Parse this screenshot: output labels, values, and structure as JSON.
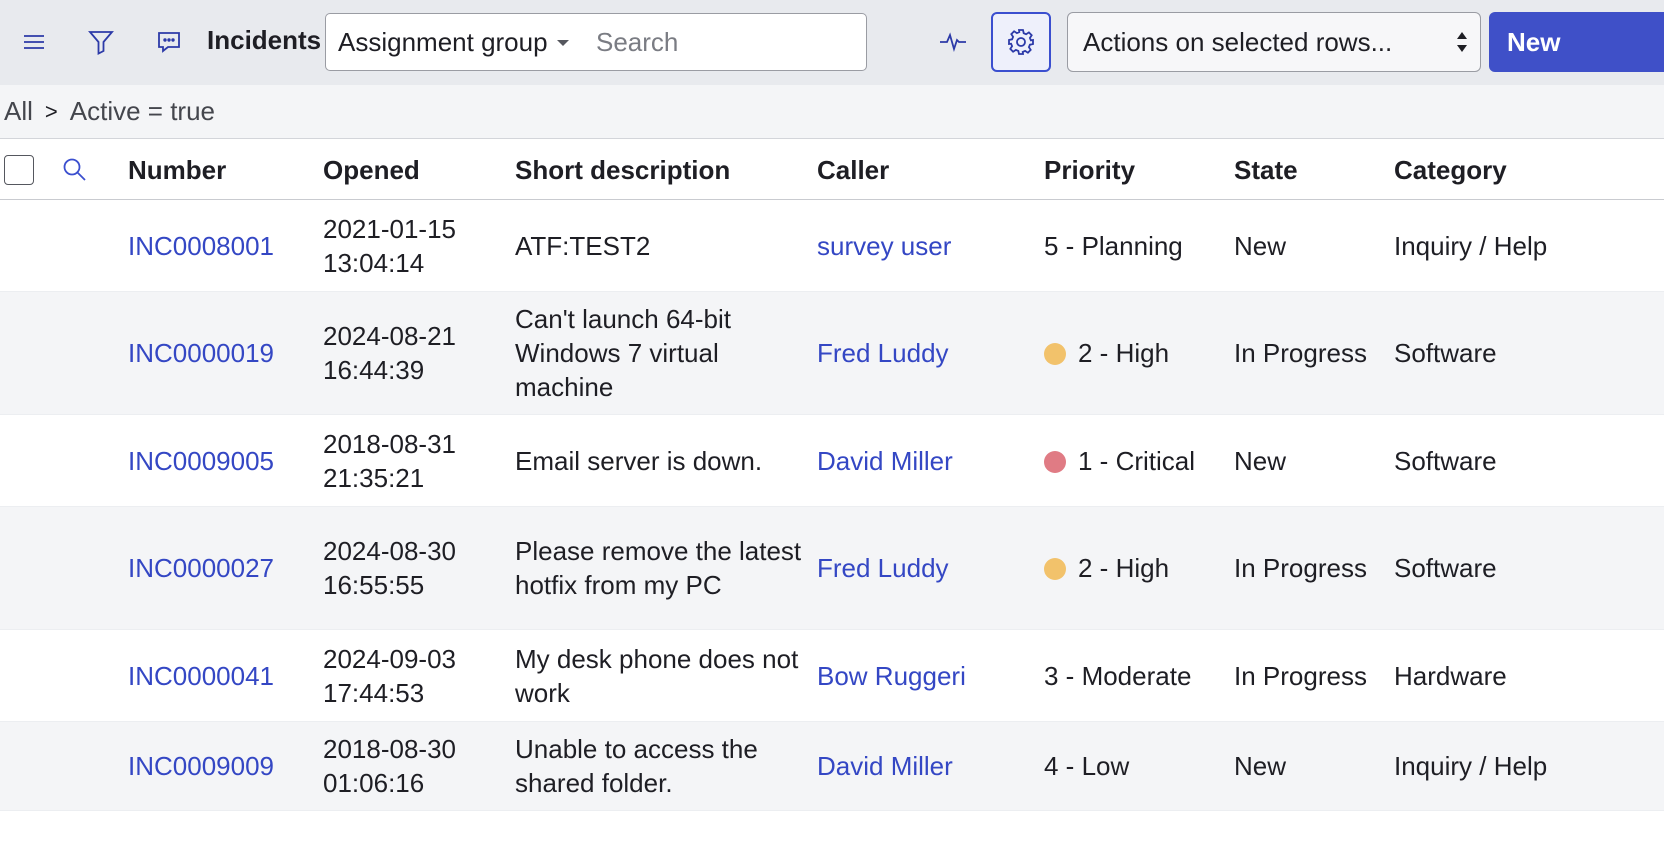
{
  "header": {
    "menu_icon": "hamburger-menu-icon",
    "filter_icon": "filter-funnel-icon",
    "comment_icon": "chat-bubble-icon",
    "title": "Incidents",
    "group_select_value": "Assignment group",
    "search_placeholder": "Search",
    "activity_icon": "pulse-activity-icon",
    "settings_icon": "gear-icon",
    "actions_select_value": "Actions on selected rows...",
    "new_label": "New",
    "accent_color": "#3f50c8"
  },
  "breadcrumb": {
    "root": "All",
    "separator": ">",
    "filter": "Active = true"
  },
  "table": {
    "columns": [
      "Number",
      "Opened",
      "Short description",
      "Caller",
      "Priority",
      "State",
      "Category"
    ],
    "rows": [
      {
        "number": "INC0008001",
        "opened": [
          "2021-01-15",
          "13:04:14"
        ],
        "description": "ATF:TEST2",
        "caller": "survey user",
        "priority": "5 - Planning",
        "priority_dot": "",
        "state": "New",
        "category": "Inquiry / Help"
      },
      {
        "number": "INC0000019",
        "opened": [
          "2024-08-21",
          "16:44:39"
        ],
        "description": "Can't launch 64-bit Windows 7 virtual machine",
        "caller": "Fred Luddy",
        "priority": "2 - High",
        "priority_dot": "#f2c26b",
        "state": "In Progress",
        "category": "Software"
      },
      {
        "number": "INC0009005",
        "opened": [
          "2018-08-31",
          "21:35:21"
        ],
        "description": "Email server is down.",
        "caller": "David Miller",
        "priority": "1 - Critical",
        "priority_dot": "#e07b84",
        "state": "New",
        "category": "Software"
      },
      {
        "number": "INC0000027",
        "opened": [
          "2024-08-30",
          "16:55:55"
        ],
        "description": "Please remove the latest hotfix from my PC",
        "caller": "Fred Luddy",
        "priority": "2 - High",
        "priority_dot": "#f2c26b",
        "state": "In Progress",
        "category": "Software"
      },
      {
        "number": "INC0000041",
        "opened": [
          "2024-09-03",
          "17:44:53"
        ],
        "description": "My desk phone does not work",
        "caller": "Bow Ruggeri",
        "priority": "3 - Moderate",
        "priority_dot": "",
        "state": "In Progress",
        "category": "Hardware"
      },
      {
        "number": "INC0009009",
        "opened": [
          "2018-08-30",
          "01:06:16"
        ],
        "description": "Unable to access the shared folder.",
        "caller": "David Miller",
        "priority": "4 - Low",
        "priority_dot": "",
        "state": "New",
        "category": "Inquiry / Help"
      }
    ]
  }
}
